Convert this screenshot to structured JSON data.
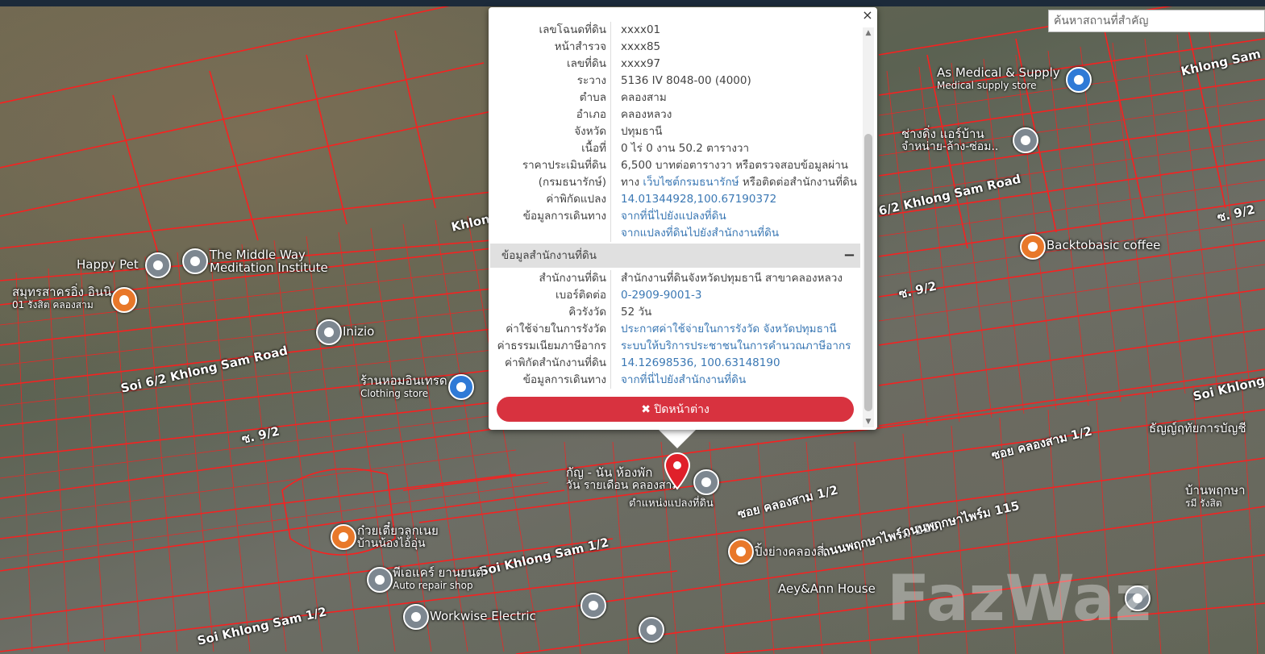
{
  "search": {
    "placeholder": "ค้นหาสถานที่สำคัญ"
  },
  "popup": {
    "close_icon": "×",
    "details": [
      {
        "label": "เลขโฉนดที่ดิน",
        "value": "xxxx01"
      },
      {
        "label": "หน้าสำรวจ",
        "value": "xxxx85"
      },
      {
        "label": "เลขที่ดิน",
        "value": "xxxx97"
      },
      {
        "label": "ระวาง",
        "value": "5136 IV 8048-00 (4000)"
      },
      {
        "label": "ตำบล",
        "value": "คลองสาม"
      },
      {
        "label": "อำเภอ",
        "value": "คลองหลวง"
      },
      {
        "label": "จังหวัด",
        "value": "ปทุมธานี"
      },
      {
        "label": "เนื้อที่",
        "value": "0 ไร่ 0 งาน 50.2 ตารางวา"
      },
      {
        "label": "ราคาประเมินที่ดิน",
        "value": "6,500 บาทต่อตารางวา หรือตรวจสอบข้อมูลผ่าน"
      }
    ],
    "dept_row": {
      "label": "(กรมธนารักษ์)",
      "pre": "ทาง ",
      "link": "เว็บไซต์กรมธนารักษ์",
      "post": " หรือติดต่อสำนักงานที่ดิน"
    },
    "coord_row": {
      "label": "ค่าพิกัดแปลง",
      "value": "14.01344928,100.67190372"
    },
    "travel_rows": {
      "label": "ข้อมูลการเดินทาง",
      "link1": "จากที่นี่ไปยังแปลงที่ดิน",
      "link2": "จากแปลงที่ดินไปยังสำนักงานที่ดิน"
    },
    "section_title": "ข้อมูลสำนักงานที่ดิน",
    "section_toggle": "−",
    "office": [
      {
        "label": "สำนักงานที่ดิน",
        "value": "สำนักงานที่ดินจังหวัดปทุมธานี สาขาคลองหลวง",
        "link": false
      },
      {
        "label": "เบอร์ติดต่อ",
        "value": "0-2909-9001-3",
        "link": true
      },
      {
        "label": "คิวรังวัด",
        "value": "52 วัน",
        "link": false
      },
      {
        "label": "ค่าใช้จ่ายในการรังวัด",
        "value": "ประกาศค่าใช้จ่ายในการรังวัด จังหวัดปทุมธานี",
        "link": true
      },
      {
        "label": "ค่าธรรมเนียมภาษีอากร",
        "value": "ระบบให้บริการประชาชนในการคำนวณภาษีอากร",
        "link": true
      },
      {
        "label": "ค่าพิกัดสำนักงานที่ดิน",
        "value": "14.12698536, 100.63148190",
        "link": true
      },
      {
        "label": "ข้อมูลการเดินทาง",
        "value": "จากที่นี่ไปยังสำนักงานที่ดิน",
        "link": true
      }
    ],
    "close_button": "✖ ปิดหน้าต่าง"
  },
  "map": {
    "marker_label": "ตำแหน่งแปลงที่ดิน",
    "roads": [
      "Soi 6/2 Khlong Sam Road",
      "6/2 Khlong Sam Road",
      "Soi Khlong Sam 1/2",
      "Soi Khlong Sam 1/2",
      "ซอย คลองสาม 1/2",
      "ซอย คลองสาม 1/2",
      "ถนนพฤกษาไพร์ม 115",
      "ถนนพฤกษาไพร์ม 115",
      "ซ. 9/2",
      "ซ. 9/2",
      "ซ. 9/2",
      "Khlong Sam",
      "Soi Khlong",
      "Khlong"
    ],
    "pois": [
      {
        "name": "Happy Pet",
        "sub": ""
      },
      {
        "name": "The Middle Way",
        "sub": "Meditation Institute"
      },
      {
        "name": "สมุทรสาครอิ่ง อินนิ",
        "sub": "01 รังสิต คลองสาม"
      },
      {
        "name": "Inizio",
        "sub": ""
      },
      {
        "name": "ร้านหอมอินเทรด",
        "sub": "Clothing store"
      },
      {
        "name": "As Medical & Supply",
        "sub": "Medical supply store"
      },
      {
        "name": "ช่างดิ่ง แอร์บ้าน",
        "sub": "จำหน่าย-ล้าง-ซ่อม.."
      },
      {
        "name": "Backtobasic coffee",
        "sub": ""
      },
      {
        "name": "กัญ - นัน ห้องพัก",
        "sub": "วัน รายเดือน คลองสาม"
      },
      {
        "name": "ก๋วยเตี๋ยวลูกเนย",
        "sub": "บ้านน้องไอ้อุ่น"
      },
      {
        "name": "พีเอแคร์ ยานยนต์",
        "sub": "Auto repair shop"
      },
      {
        "name": "Workwise Electric",
        "sub": ""
      },
      {
        "name": "ปิ้งย่างคลองสี่",
        "sub": ""
      },
      {
        "name": "Aey&Ann House",
        "sub": ""
      },
      {
        "name": "ธัญญ์ฤทัยการบัญชี",
        "sub": ""
      },
      {
        "name": "บ้านพฤกษา",
        "sub": "รมี รังสิต"
      }
    ],
    "watermark": "FazWaz"
  }
}
